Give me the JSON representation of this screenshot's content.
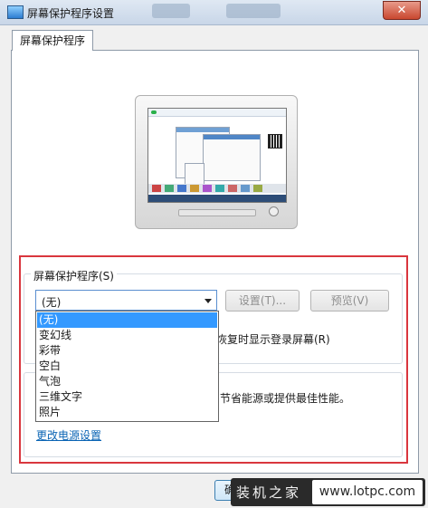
{
  "window": {
    "title": "屏幕保护程序设置",
    "close_glyph": "✕"
  },
  "tabs": [
    {
      "label": "屏幕保护程序"
    }
  ],
  "screensaver": {
    "group_label": "屏幕保护程序(S)",
    "selected": "(无)",
    "settings_button": "设置(T)...",
    "preview_button": "预览(V)",
    "options": [
      "(无)",
      "变幻线",
      "彩带",
      "空白",
      "气泡",
      "三维文字",
      "照片"
    ],
    "checkbox_label_visible": "恢复时显示登录屏幕(R)"
  },
  "power": {
    "description_visible": "节省能源或提供最佳性能。",
    "link": "更改电源设置"
  },
  "footer": {
    "ok_button_visible": "确"
  },
  "watermark": {
    "left": "装机之家",
    "right": "www.lotpc.com"
  },
  "colors": {
    "highlight": "#d9363e",
    "selection": "#3399ff",
    "link": "#0a64b4"
  }
}
